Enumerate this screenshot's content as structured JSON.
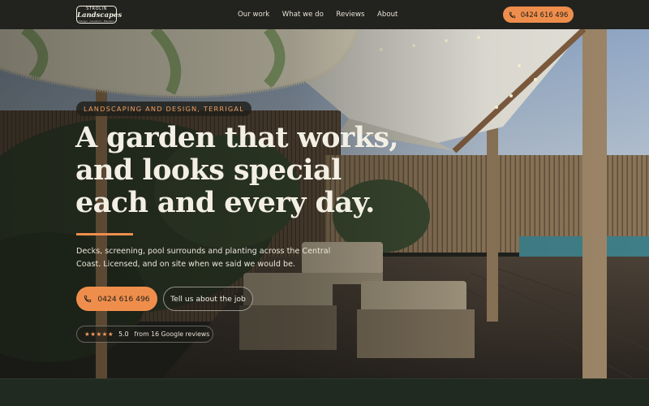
{
  "brand": {
    "top": "STROLIN",
    "name": "Landscapes",
    "tagline": "Design · Construct · Maintain"
  },
  "nav": {
    "links": [
      "Our work",
      "What we do",
      "Reviews",
      "About"
    ],
    "phone": "0424 616 496"
  },
  "hero": {
    "eyebrow": "LANDSCAPING AND DESIGN, TERRIGAL",
    "headline": [
      "A garden that works,",
      "and looks special",
      "each and every day."
    ],
    "lede": "Decks, screening, pool surrounds and planting across the Central Coast. Licensed, and on site when we said we would be.",
    "primary_cta": "0424 616 496",
    "secondary_cta": "Tell us about the job",
    "rating": {
      "stars": 5,
      "score": "5.0",
      "text": "from 16 Google reviews"
    }
  },
  "colors": {
    "accent": "#ef8e4c",
    "nav_bg": "#22231f",
    "text": "#f3efe4"
  }
}
